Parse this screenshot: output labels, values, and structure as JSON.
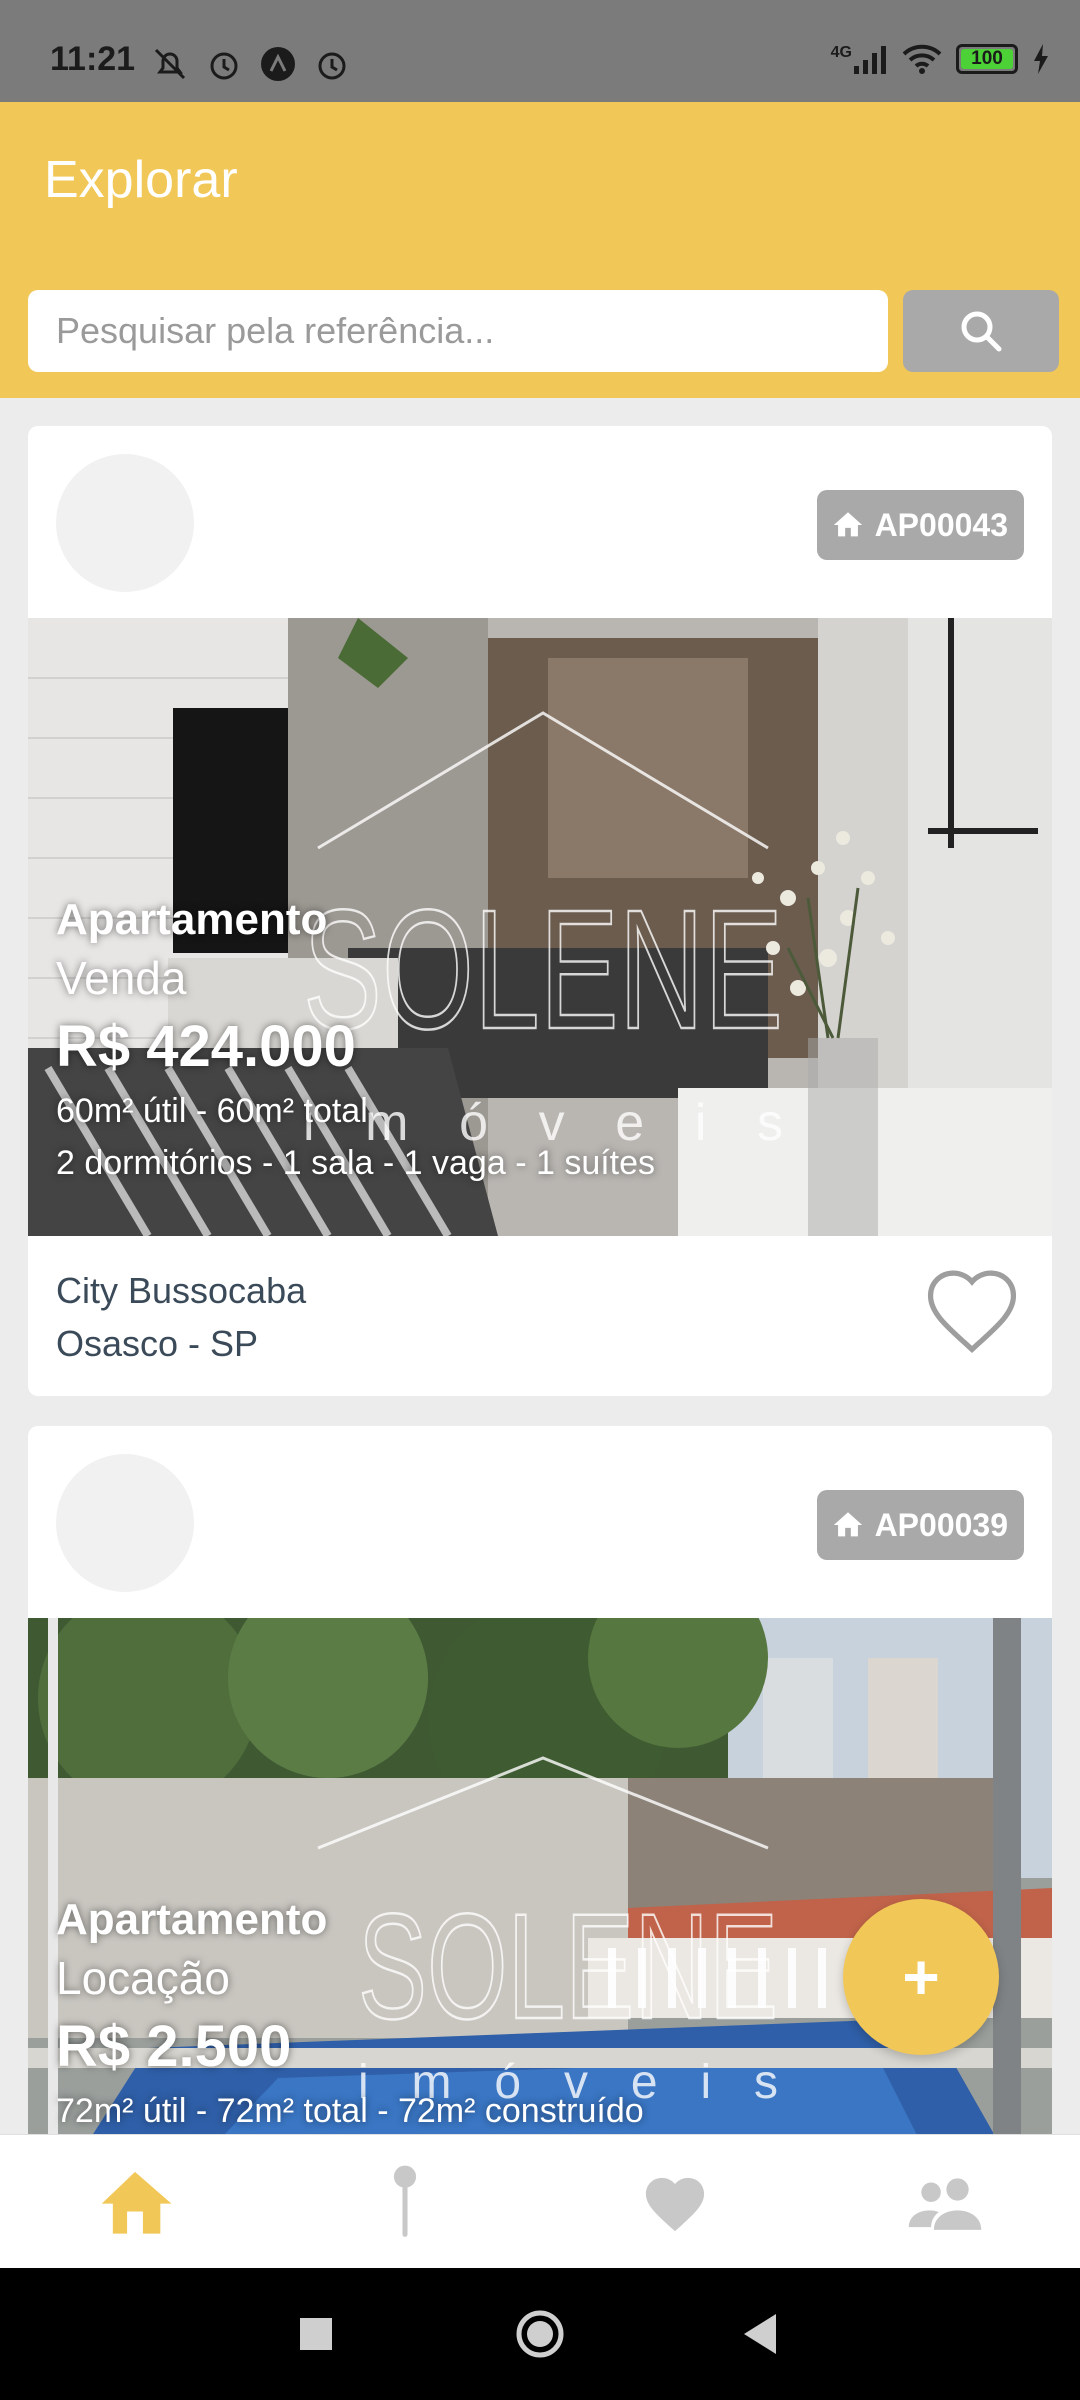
{
  "status_bar": {
    "time": "11:21",
    "network": "4G",
    "battery": "100",
    "icons": [
      "mute-icon",
      "alarm-icon",
      "app-icon",
      "alarm-icon",
      "signal-icon",
      "wifi-icon",
      "battery-icon",
      "charging-icon"
    ]
  },
  "header": {
    "title": "Explorar",
    "search_placeholder": "Pesquisar pela referência..."
  },
  "listings": [
    {
      "reference": "AP00043",
      "type": "Apartamento",
      "deal": "Venda",
      "price": "R$ 424.000",
      "area": "60m² útil - 60m² total",
      "rooms": "2 dormitórios - 1 sala - 1 vaga - 1 suítes",
      "neighborhood": "City Bussocaba",
      "city": "Osasco - SP",
      "watermark_brand": "SOLENE",
      "watermark_sub": "i m ó v e i s"
    },
    {
      "reference": "AP00039",
      "type": "Apartamento",
      "deal": "Locação",
      "price": "R$ 2.500",
      "area": "72m² útil - 72m² total - 72m² construído",
      "watermark_brand": "SOLENE",
      "watermark_sub": "i m ó v e i s"
    }
  ],
  "fab_label": "+",
  "bottom_nav": [
    {
      "icon": "home-icon",
      "active": true
    },
    {
      "icon": "map-pin-icon",
      "active": false
    },
    {
      "icon": "heart-icon",
      "active": false
    },
    {
      "icon": "people-icon",
      "active": false
    }
  ],
  "colors": {
    "accent": "#f1c757",
    "badge": "#a9a9a9",
    "inactive_icon": "#c8c8c8"
  }
}
